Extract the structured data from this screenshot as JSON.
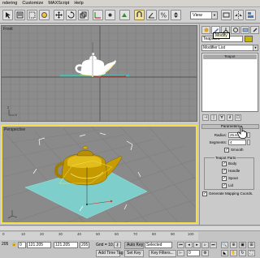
{
  "menu": [
    "ndering",
    "Customize",
    "MAXScript",
    "Help"
  ],
  "toolbar": {
    "buttons": [
      "select-icon",
      "select-by-name-icon",
      "region-select-icon",
      "window-crossing-icon",
      "move-icon",
      "rotate-icon",
      "scale-icon",
      "reference-coord-icon",
      "pivot-icon",
      "select-manipulate-icon",
      "snap-toggle-icon",
      "angle-snap-icon",
      "percent-snap-icon",
      "spinner-snap-icon",
      "named-selection-icon"
    ],
    "view_select": "View"
  },
  "viewports": {
    "front": {
      "label": "Front"
    },
    "perspective": {
      "label": "Perspective"
    }
  },
  "command_panel": {
    "tab_icons": [
      "create-icon",
      "modify-icon",
      "hierarchy-icon",
      "motion-icon",
      "display-icon",
      "utilities-icon"
    ],
    "object_name": "Teapot01",
    "object_color": "#c6b600",
    "tooltip": "Modify",
    "modifier_list": "Modifier List",
    "stack_item": "Teapot",
    "rollout_title": "Parameters",
    "radius_label": "Radius:",
    "radius_value": "25.679",
    "segments_label": "Segments:",
    "segments_value": "4",
    "smooth_label": "Smooth",
    "teapot_parts_title": "Teapot Parts",
    "parts": [
      {
        "label": "Body",
        "checked": true
      },
      {
        "label": "Handle",
        "checked": true
      },
      {
        "label": "Spout",
        "checked": true
      },
      {
        "label": "Lid",
        "checked": true
      }
    ],
    "mapping_label": "Generate Mapping Coords.",
    "check_mark": "✓"
  },
  "timeline": {
    "ticks": [
      "205",
      "0",
      "121",
      "205",
      "0",
      "121",
      "205"
    ],
    "ruler": [
      "0",
      "10",
      "20",
      "30",
      "40",
      "50",
      "60",
      "70",
      "80",
      "90",
      "100"
    ]
  },
  "status": {
    "x_val": "121.205",
    "y_val": "121.205",
    "grid": "Grid = 10.0",
    "add_time_tag": "Add Time Tag",
    "auto_key": "Auto Key",
    "set_key": "Set Key",
    "selected": "Selected",
    "key_filters": "Key Filters...",
    "frame": "0"
  }
}
